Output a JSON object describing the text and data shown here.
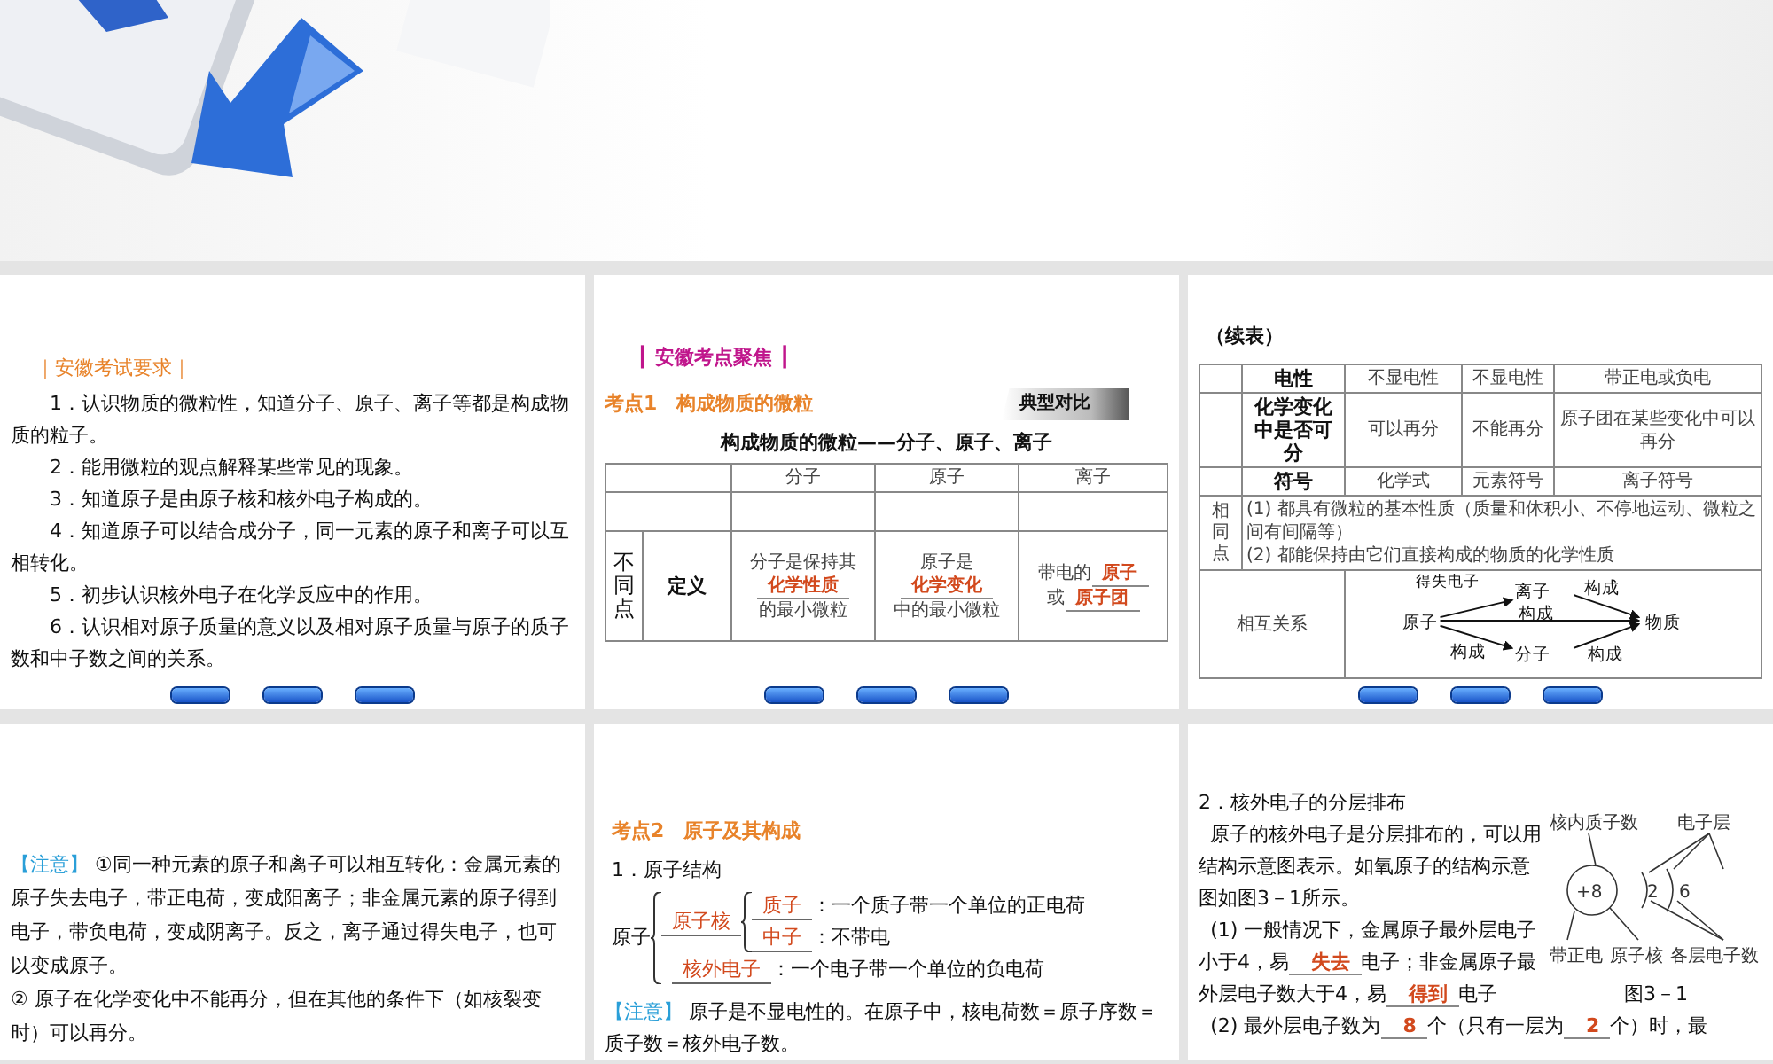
{
  "banner": {
    "kind": "arrows"
  },
  "slides": [
    {
      "kind": "requirements",
      "heading": "｜安徽考试要求｜",
      "items": [
        "1．认识物质的微粒性，知道分子、原子、离子等都是构成物质的粒子。",
        "2．能用微粒的观点解释某些常见的现象。",
        "3．知道原子是由原子核和核外电子构成的。",
        "4．知道原子可以结合成分子，同一元素的原子和离子可以互相转化。",
        "5．初步认识核外电子在化学反应中的作用。",
        "6．认识相对原子质量的意义以及相对原子质量与原子的质子数和中子数之间的关系。"
      ],
      "nav_bar": true
    },
    {
      "kind": "focus",
      "heading": "┃ 安徽考点聚焦 ┃",
      "topic": "考点1　构成物质的微粒",
      "tag": "典型对比",
      "table_title": "构成物质的微粒——分子、原子、离子",
      "columns": [
        "分子",
        "原子",
        "离子"
      ],
      "row_group": "不同点",
      "row_label": "定义",
      "cells": [
        [
          [
            {
              "kind": "text",
              "text": "分子是保持其"
            }
          ],
          [
            {
              "kind": "blank",
              "text": "化学性质"
            }
          ],
          [
            {
              "kind": "text",
              "text": "的最小微粒"
            }
          ]
        ],
        [
          [
            {
              "kind": "text",
              "text": "原子是"
            }
          ],
          [
            {
              "kind": "blank",
              "text": "化学变化"
            }
          ],
          [
            {
              "kind": "text",
              "text": "中的最小微粒"
            }
          ]
        ],
        [
          [
            {
              "kind": "text",
              "text": "带电的"
            },
            {
              "kind": "blank",
              "text": "原子"
            }
          ],
          [
            {
              "kind": "text",
              "text": "或"
            },
            {
              "kind": "blank",
              "text": "原子团"
            }
          ]
        ]
      ],
      "nav_bar": true
    },
    {
      "kind": "table_cont",
      "caption": "（续表）",
      "rows": [
        {
          "label": "电性",
          "cells": [
            "不显电性",
            "不显电性",
            "带正电或负电"
          ]
        },
        {
          "label": "化学变化中是否可分",
          "cells": [
            "可以再分",
            "不能再分",
            "原子团在某些变化中可以再分"
          ]
        },
        {
          "label": "符号",
          "cells": [
            "化学式",
            "元素符号",
            "离子符号"
          ]
        }
      ],
      "same_label": "相同点",
      "same_text": [
        "(1) 都具有微粒的基本性质（质量和体积小、不停地运动、微粒之间有间隔等）",
        "(2) 都能保持由它们直接构成的物质的化学性质"
      ],
      "relation_label": "相互关系",
      "relation": {
        "atom": "原子",
        "ion": "离子",
        "matter": "物质",
        "molecule": "分子",
        "arrow_labels": [
          "得失电子",
          "构成",
          "构成",
          "构成",
          "构成"
        ]
      },
      "nav_bar": true
    },
    {
      "kind": "note",
      "note_label": "【注意】",
      "paragraphs": [
        "①同一种元素的原子和离子可以相互转化：金属元素的原子失去电子，带正电荷，变成阳离子；非金属元素的原子得到电子，带负电荷，变成阴离子。反之，离子通过得失电子，也可以变成原子。",
        "② 原子在化学变化中不能再分，但在其他的条件下（如核裂变时）可以再分。"
      ]
    },
    {
      "kind": "structure",
      "topic": "考点2　原子及其构成",
      "subheading": "1．原子结构",
      "root": "原子",
      "nucleus": "原子核",
      "nucleus_parts": [
        {
          "answer": "质子",
          "desc": "：一个质子带一个单位的正电荷"
        },
        {
          "answer": "中子",
          "desc": "：不带电"
        }
      ],
      "electron": {
        "answer": "核外电子",
        "desc": "：一个电子带一个单位的负电荷"
      },
      "note_label": "【注意】",
      "note": "原子是不显电性的。在原子中，核电荷数＝原子序数＝质子数＝核外电子数。"
    },
    {
      "kind": "layers",
      "heading": "2．核外电子的分层排布",
      "paragraph": "原子的核外电子是分层排布的，可以用结构示意图表示。如氧原子的结构示意图如图3－1所示。",
      "point1": [
        {
          "kind": "text",
          "text": "(1) 一般情况下，金属原子最外层电子小于4，易"
        },
        {
          "kind": "blank",
          "text": "失去"
        },
        {
          "kind": "text",
          "text": "电子；非金属原子最外层电子数大于4，易"
        },
        {
          "kind": "blank",
          "text": "得到"
        },
        {
          "kind": "text",
          "text": "电子"
        }
      ],
      "point2": [
        {
          "kind": "text",
          "text": "(2) 最外层电子数为"
        },
        {
          "kind": "blank",
          "text": "8"
        },
        {
          "kind": "text",
          "text": "个（只有一层为"
        },
        {
          "kind": "blank",
          "text": "2"
        },
        {
          "kind": "text",
          "text": "个）时，最"
        }
      ],
      "figure": {
        "top_labels": [
          "核内质子数",
          "电子层"
        ],
        "nucleus": "+8",
        "shells": [
          "2",
          "6"
        ],
        "bottom_labels": [
          "带正电",
          "原子核",
          "各层电子数"
        ],
        "caption": "图3－1"
      }
    }
  ]
}
